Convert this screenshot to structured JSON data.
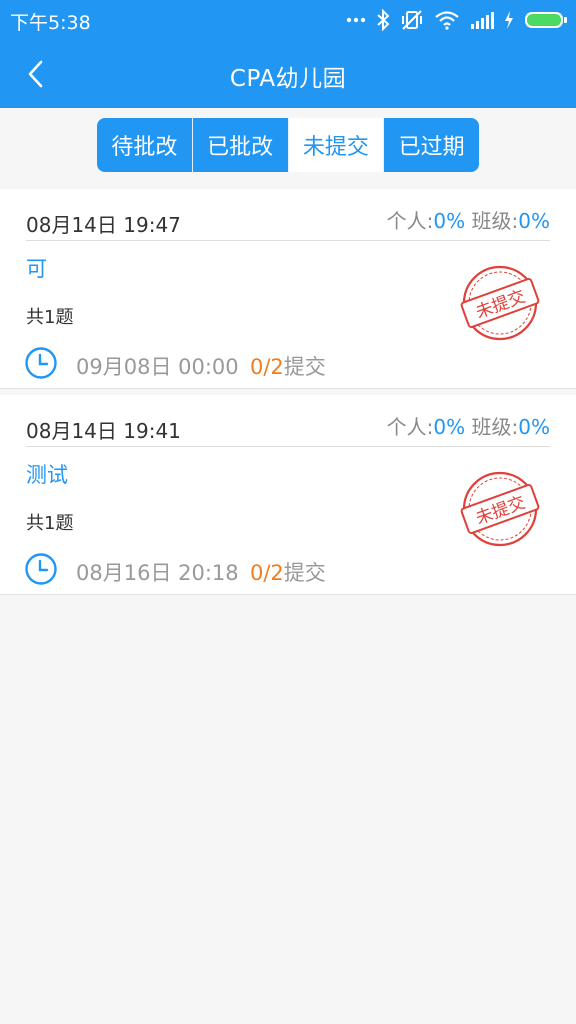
{
  "status_bar": {
    "time": "下午5:38",
    "icons": [
      "more-dots-icon",
      "bluetooth-icon",
      "vibrate-icon",
      "wifi-icon",
      "signal-icon",
      "charging-icon",
      "battery-icon"
    ]
  },
  "app_bar": {
    "title": "CPA幼儿园"
  },
  "tabs": [
    {
      "label": "待批改"
    },
    {
      "label": "已批改"
    },
    {
      "label": "未提交"
    },
    {
      "label": "已过期"
    }
  ],
  "active_tab_index": 2,
  "labels": {
    "personal": "个人:",
    "class": "班级:",
    "submit": "提交"
  },
  "assignments": [
    {
      "date": "08月14日 19:47",
      "personal_pct": "0%",
      "class_pct": "0%",
      "name": "可",
      "count": "共1题",
      "deadline": "09月08日 00:00",
      "progress": "0/2",
      "stamp": "未提交"
    },
    {
      "date": "08月14日 19:41",
      "personal_pct": "0%",
      "class_pct": "0%",
      "name": "测试",
      "count": "共1题",
      "deadline": "08月16日 20:18",
      "progress": "0/2",
      "stamp": "未提交"
    }
  ],
  "colors": {
    "primary": "#2196F3",
    "orange": "#F07D1F",
    "stamp_red": "#E0403A",
    "battery_green": "#4CD964"
  }
}
